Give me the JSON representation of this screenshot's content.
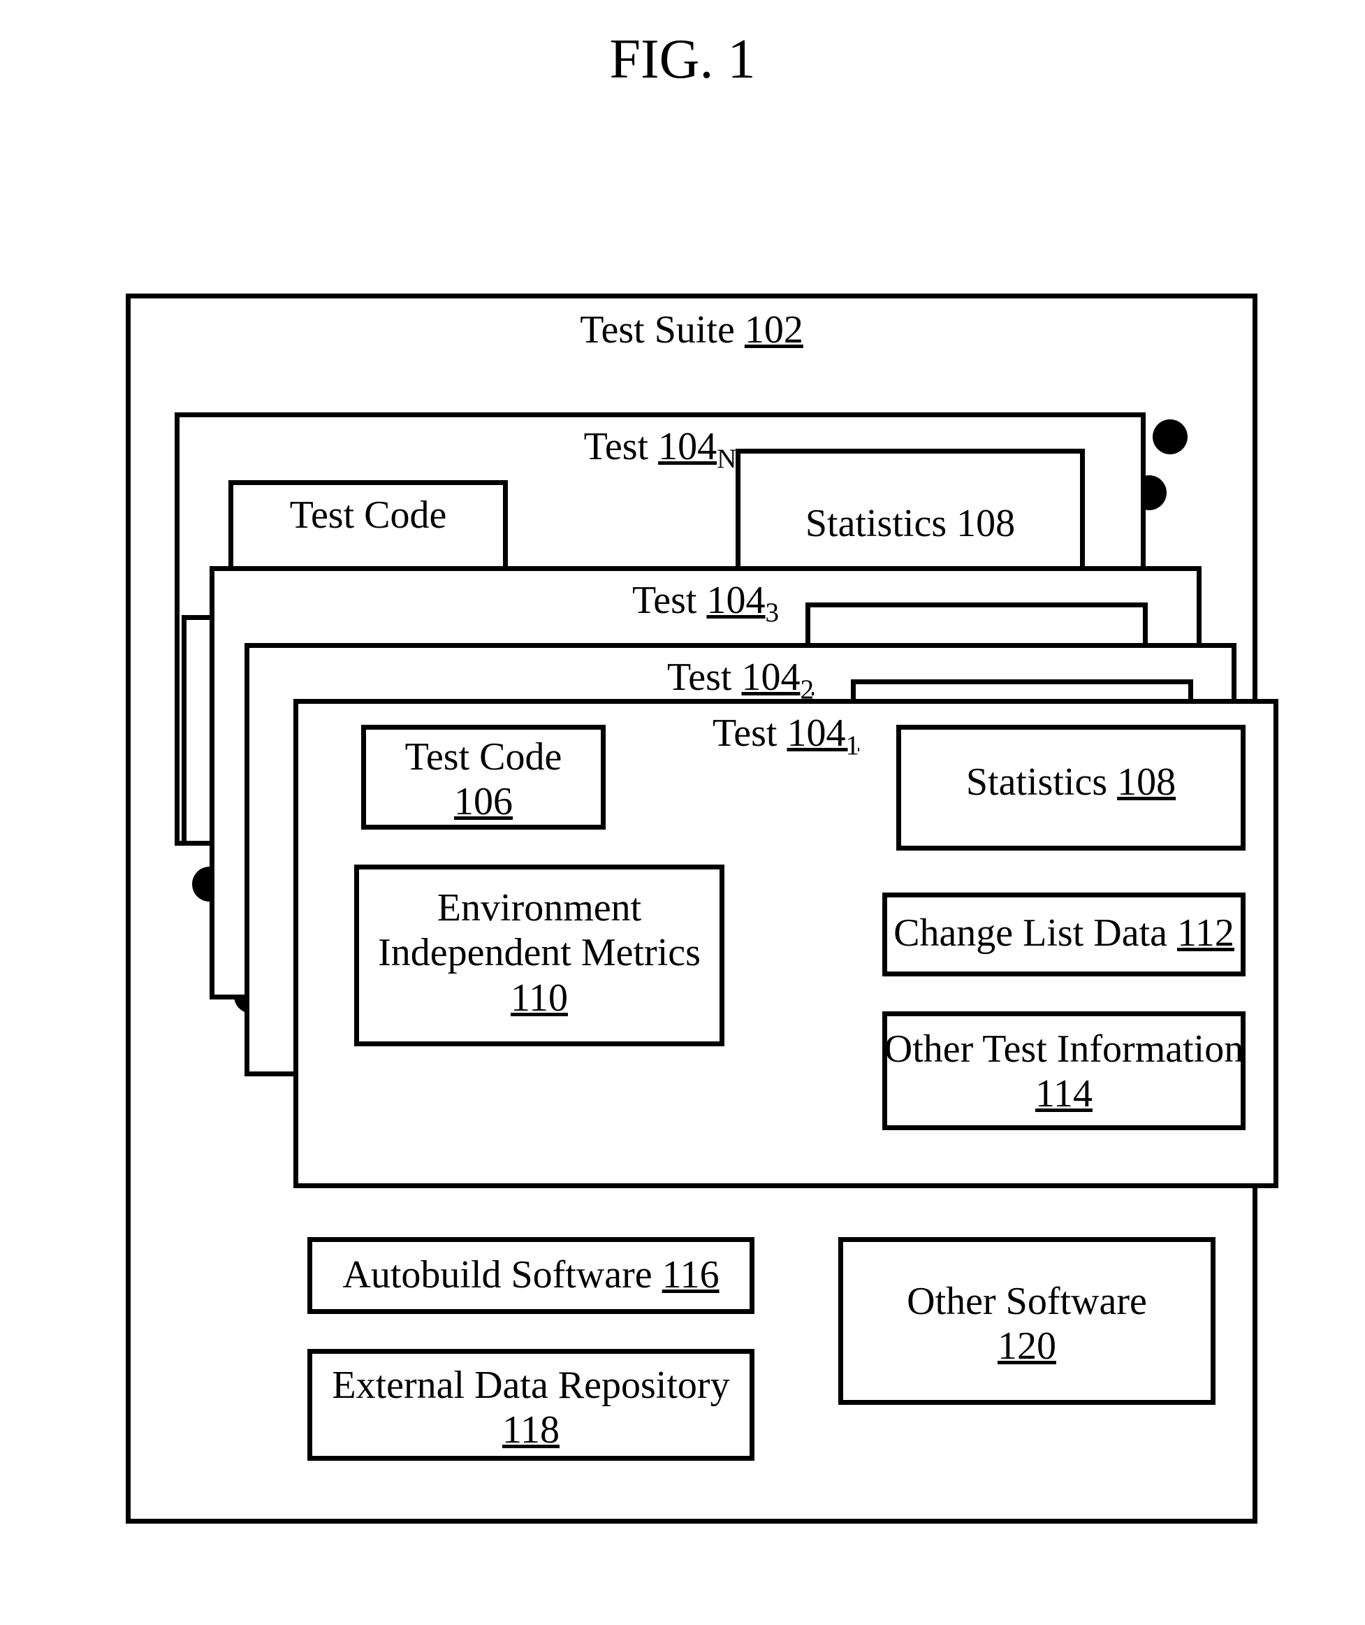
{
  "figure_title": "FIG. 1",
  "suite": {
    "label_text": "Test Suite",
    "label_num": "102"
  },
  "tests": {
    "N": {
      "label_text": "Test",
      "label_num": "104",
      "sub": "N",
      "code_text": "Test Code",
      "stat_text": "Statistics 108"
    },
    "3": {
      "label_text": "Test",
      "label_num": "104",
      "sub": "3"
    },
    "2": {
      "label_text": "Test",
      "label_num": "104",
      "sub": "2"
    },
    "1": {
      "label_text": "Test",
      "label_num": "104",
      "sub": "1",
      "code_text": "Test Code",
      "code_num": "106",
      "env_text": "Environment Independent Metrics",
      "env_num": "110",
      "stat_text": "Statistics",
      "stat_num": "108",
      "chg_text": "Change List Data",
      "chg_num": "112",
      "oth_text": "Other Test Information",
      "oth_num": "114"
    }
  },
  "bottom": {
    "autobuild_text": "Autobuild Software",
    "autobuild_num": "116",
    "repo_text": "External Data Repository",
    "repo_num": "118",
    "osw_text": "Other Software",
    "osw_num": "120"
  }
}
